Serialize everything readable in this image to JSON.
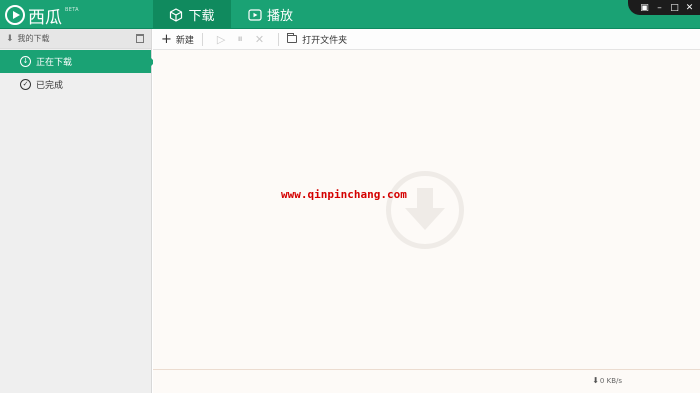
{
  "app": {
    "name": "西瓜",
    "badge": "BETA"
  },
  "tabs": [
    {
      "label": "下载",
      "icon": "box-icon",
      "active": true
    },
    {
      "label": "播放",
      "icon": "play-screen-icon",
      "active": false
    }
  ],
  "window_controls": {
    "menu": "▣",
    "minimize": "–",
    "maximize": "□",
    "close": "✕"
  },
  "sidebar": {
    "header": "我的下载",
    "items": [
      {
        "label": "正在下载",
        "icon": "download-circle-icon",
        "active": true
      },
      {
        "label": "已完成",
        "icon": "check-circle-icon",
        "active": false
      }
    ]
  },
  "toolbar": {
    "new_label": "新建",
    "open_folder_label": "打开文件夹"
  },
  "main": {
    "watermark": "www.qinpinchang.com"
  },
  "status": {
    "speed": "0 KB/s"
  },
  "colors": {
    "accent": "#1aa274",
    "accent_dark": "#108a5e",
    "watermark_red": "#d40000"
  }
}
